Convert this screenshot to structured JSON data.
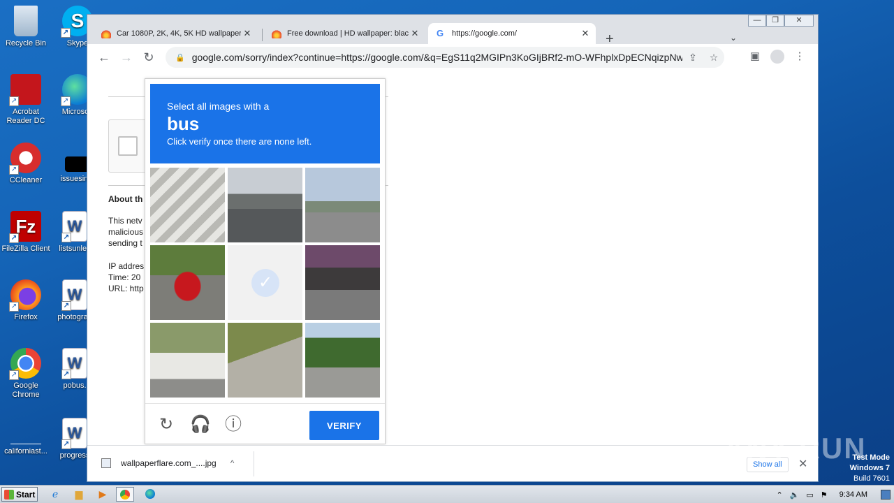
{
  "desktop": {
    "icons": [
      {
        "label": "Recycle Bin",
        "icon": "recycle-bin-icon"
      },
      {
        "label": "Skype",
        "icon": "skype-icon"
      },
      {
        "label": "Acrobat Reader DC",
        "icon": "acrobat-icon"
      },
      {
        "label": "Microsoft",
        "icon": "edge-icon"
      },
      {
        "label": "CCleaner",
        "icon": "ccleaner-icon"
      },
      {
        "label": "issuesimp",
        "icon": "file-icon"
      },
      {
        "label": "FileZilla Client",
        "icon": "filezilla-icon"
      },
      {
        "label": "listsunles",
        "icon": "word-doc-icon"
      },
      {
        "label": "Firefox",
        "icon": "firefox-icon"
      },
      {
        "label": "photograp",
        "icon": "word-doc-icon"
      },
      {
        "label": "Google Chrome",
        "icon": "chrome-icon"
      },
      {
        "label": "pobus.",
        "icon": "word-doc-icon"
      },
      {
        "label": "californiast...",
        "icon": "file-icon"
      },
      {
        "label": "progress",
        "icon": "word-doc-icon"
      }
    ]
  },
  "browser": {
    "tabs": [
      {
        "title": "Car 1080P, 2K, 4K, 5K HD wallpaper",
        "favicon": "fire-icon"
      },
      {
        "title": "Free download | HD wallpaper: black",
        "favicon": "fire-icon"
      },
      {
        "title": "https://google.com/",
        "favicon": "google-icon",
        "active": true
      }
    ],
    "url": "google.com/sorry/index?continue=https://google.com/&q=EgS11q2MGIPn3KoGIjBRf2-mO-WFhplxDpECNqizpNwq...",
    "page": {
      "about_heading": "About th",
      "para_lines": "This netv\nmalicious\nsending t",
      "info_lines": "IP addres\nTime: 20\nURL: http"
    },
    "captcha": {
      "line1": "Select all images with a",
      "target": "bus",
      "line3": "Click verify once there are none left.",
      "verify_label": "VERIFY"
    },
    "download": {
      "filename": "wallpaperflare.com_....jpg",
      "show_all": "Show all"
    }
  },
  "taskbar": {
    "start_label": "Start",
    "clock": "9:34 AM"
  },
  "watermark": "ANY RUN",
  "test_mode": {
    "line1": "Test Mode",
    "line2": "Windows 7",
    "line3": "Build 7601"
  }
}
